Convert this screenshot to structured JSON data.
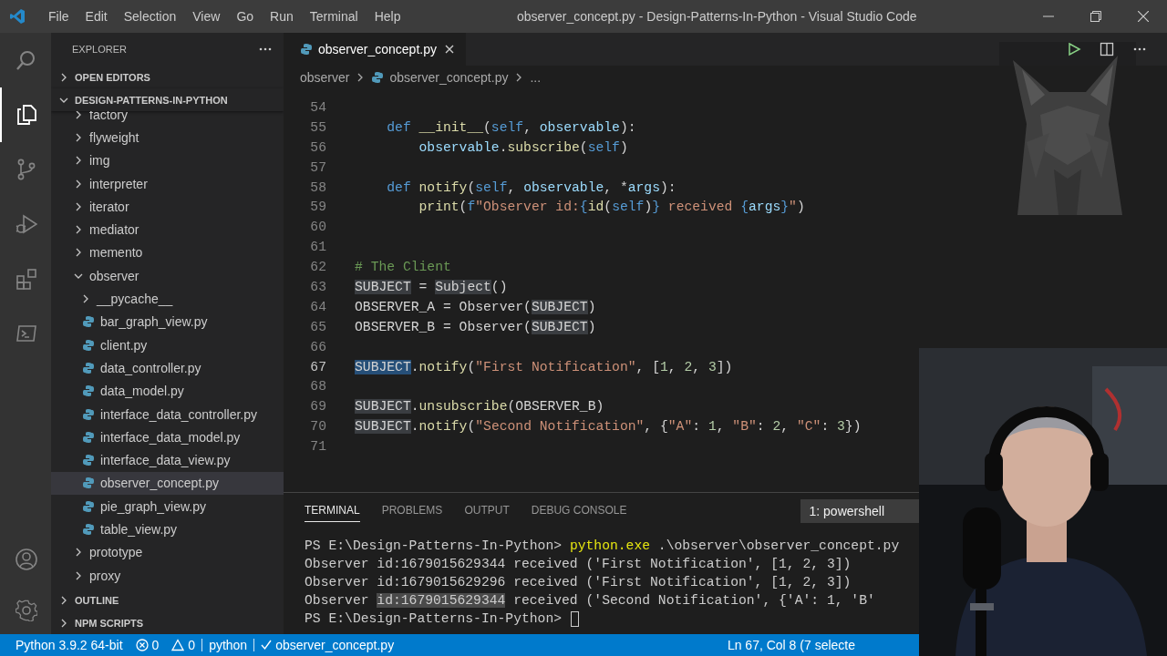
{
  "window": {
    "title": "observer_concept.py - Design-Patterns-In-Python - Visual Studio Code"
  },
  "menu": [
    "File",
    "Edit",
    "Selection",
    "View",
    "Go",
    "Run",
    "Terminal",
    "Help"
  ],
  "activity_bar": [
    {
      "kind": "search",
      "selected": false
    },
    {
      "kind": "explorer",
      "selected": true
    },
    {
      "kind": "source-control",
      "selected": false
    },
    {
      "kind": "run-debug",
      "selected": false
    },
    {
      "kind": "extensions",
      "selected": false
    },
    {
      "kind": "terminal",
      "selected": false
    },
    {
      "kind": "account",
      "selected": false
    },
    {
      "kind": "settings",
      "selected": false
    }
  ],
  "sidebar": {
    "title": "EXPLORER",
    "sections": [
      {
        "label": "OPEN EDITORS",
        "expanded": false
      },
      {
        "label": "DESIGN-PATTERNS-IN-PYTHON",
        "expanded": true,
        "tree": [
          {
            "label": "factory",
            "kind": "folder",
            "expanded": false,
            "selected": false
          },
          {
            "label": "flyweight",
            "kind": "folder",
            "expanded": false,
            "selected": false
          },
          {
            "label": "img",
            "kind": "folder",
            "expanded": false,
            "selected": false
          },
          {
            "label": "interpreter",
            "kind": "folder",
            "expanded": false,
            "selected": false
          },
          {
            "label": "iterator",
            "kind": "folder",
            "expanded": false,
            "selected": false
          },
          {
            "label": "mediator",
            "kind": "folder",
            "expanded": false,
            "selected": false
          },
          {
            "label": "memento",
            "kind": "folder",
            "expanded": false,
            "selected": false
          },
          {
            "label": "observer",
            "kind": "folder",
            "expanded": true,
            "selected": false,
            "children": [
              {
                "label": "__pycache__",
                "kind": "folder",
                "expanded": false,
                "selected": false
              },
              {
                "label": "bar_graph_view.py",
                "kind": "file",
                "selected": false
              },
              {
                "label": "client.py",
                "kind": "file",
                "selected": false
              },
              {
                "label": "data_controller.py",
                "kind": "file",
                "selected": false
              },
              {
                "label": "data_model.py",
                "kind": "file",
                "selected": false
              },
              {
                "label": "interface_data_controller.py",
                "kind": "file",
                "selected": false
              },
              {
                "label": "interface_data_model.py",
                "kind": "file",
                "selected": false
              },
              {
                "label": "interface_data_view.py",
                "kind": "file",
                "selected": false
              },
              {
                "label": "observer_concept.py",
                "kind": "file",
                "selected": true
              },
              {
                "label": "pie_graph_view.py",
                "kind": "file",
                "selected": false
              },
              {
                "label": "table_view.py",
                "kind": "file",
                "selected": false
              }
            ]
          },
          {
            "label": "prototype",
            "kind": "folder",
            "expanded": false,
            "selected": false
          },
          {
            "label": "proxy",
            "kind": "folder",
            "expanded": false,
            "selected": false
          }
        ]
      },
      {
        "label": "OUTLINE",
        "expanded": false
      },
      {
        "label": "NPM SCRIPTS",
        "expanded": false
      }
    ]
  },
  "editor": {
    "tabs": [
      {
        "label": "observer_concept.py",
        "selected": true
      }
    ],
    "breadcrumbs": [
      {
        "label": "observer",
        "kind": "folder"
      },
      {
        "label": "observer_concept.py",
        "kind": "file"
      },
      {
        "label": "...",
        "kind": "more"
      }
    ],
    "background_image": {
      "kind": "picture"
    },
    "lines": [
      {
        "number": "54",
        "current": false
      },
      {
        "number": "55",
        "current": false,
        "kind": "method",
        "tokens": [
          {
            "text": "def ",
            "kind": "keyword"
          },
          {
            "text": "__init__",
            "kind": "function"
          },
          {
            "text": "(",
            "kind": "plain"
          },
          {
            "text": "self",
            "kind": "self"
          },
          {
            "text": ", ",
            "kind": "plain"
          },
          {
            "text": "observable",
            "kind": "param"
          },
          {
            "text": "):",
            "kind": "plain"
          }
        ]
      },
      {
        "number": "56",
        "current": false,
        "kind": "body",
        "tokens": [
          {
            "text": "observable",
            "kind": "param"
          },
          {
            "text": ".",
            "kind": "plain"
          },
          {
            "text": "subscribe",
            "kind": "function"
          },
          {
            "text": "(",
            "kind": "plain"
          },
          {
            "text": "self",
            "kind": "self"
          },
          {
            "text": ")",
            "kind": "plain"
          }
        ]
      },
      {
        "number": "57",
        "current": false
      },
      {
        "number": "58",
        "current": false,
        "kind": "method",
        "tokens": [
          {
            "text": "def ",
            "kind": "keyword"
          },
          {
            "text": "notify",
            "kind": "function"
          },
          {
            "text": "(",
            "kind": "plain"
          },
          {
            "text": "self",
            "kind": "self"
          },
          {
            "text": ", ",
            "kind": "plain"
          },
          {
            "text": "observable",
            "kind": "param"
          },
          {
            "text": ", *",
            "kind": "plain"
          },
          {
            "text": "args",
            "kind": "param"
          },
          {
            "text": "):",
            "kind": "plain"
          }
        ]
      },
      {
        "number": "59",
        "current": false,
        "kind": "body",
        "tokens": [
          {
            "text": "print",
            "kind": "function"
          },
          {
            "text": "(",
            "kind": "plain"
          },
          {
            "text": "f",
            "kind": "keyword"
          },
          {
            "text": "\"Observer id:",
            "kind": "string"
          },
          {
            "text": "{",
            "kind": "keyword"
          },
          {
            "text": "id",
            "kind": "function"
          },
          {
            "text": "(",
            "kind": "plain"
          },
          {
            "text": "self",
            "kind": "self"
          },
          {
            "text": ")",
            "kind": "plain"
          },
          {
            "text": "}",
            "kind": "keyword"
          },
          {
            "text": " received ",
            "kind": "string"
          },
          {
            "text": "{",
            "kind": "keyword"
          },
          {
            "text": "args",
            "kind": "param"
          },
          {
            "text": "}",
            "kind": "keyword"
          },
          {
            "text": "\"",
            "kind": "string"
          },
          {
            "text": ")",
            "kind": "plain"
          }
        ]
      },
      {
        "number": "60",
        "current": false
      },
      {
        "number": "61",
        "current": false
      },
      {
        "number": "62",
        "current": false,
        "kind": "top",
        "tokens": [
          {
            "text": "# The Client",
            "kind": "comment"
          }
        ]
      },
      {
        "number": "63",
        "current": false,
        "kind": "top",
        "tokens": [
          {
            "text": "SUBJECT",
            "kind": "match"
          },
          {
            "text": " = ",
            "kind": "plain"
          },
          {
            "text": "Subject",
            "kind": "match"
          },
          {
            "text": "()",
            "kind": "plain"
          }
        ]
      },
      {
        "number": "64",
        "current": false,
        "kind": "top",
        "tokens": [
          {
            "text": "OBSERVER_A = Observer(",
            "kind": "plain"
          },
          {
            "text": "SUBJECT",
            "kind": "match"
          },
          {
            "text": ")",
            "kind": "plain"
          }
        ]
      },
      {
        "number": "65",
        "current": false,
        "kind": "top",
        "tokens": [
          {
            "text": "OBSERVER_B = Observer(",
            "kind": "plain"
          },
          {
            "text": "SUBJECT",
            "kind": "match"
          },
          {
            "text": ")",
            "kind": "plain"
          }
        ]
      },
      {
        "number": "66",
        "current": false
      },
      {
        "number": "67",
        "current": true,
        "kind": "top",
        "tokens": [
          {
            "text": "SUBJECT",
            "kind": "selection"
          },
          {
            "text": ".",
            "kind": "plain"
          },
          {
            "text": "notify",
            "kind": "function"
          },
          {
            "text": "(",
            "kind": "plain"
          },
          {
            "text": "\"First Notification\"",
            "kind": "string"
          },
          {
            "text": ", [",
            "kind": "plain"
          },
          {
            "text": "1",
            "kind": "number"
          },
          {
            "text": ", ",
            "kind": "plain"
          },
          {
            "text": "2",
            "kind": "number"
          },
          {
            "text": ", ",
            "kind": "plain"
          },
          {
            "text": "3",
            "kind": "number"
          },
          {
            "text": "])",
            "kind": "plain"
          }
        ]
      },
      {
        "number": "68",
        "current": false
      },
      {
        "number": "69",
        "current": false,
        "kind": "top",
        "tokens": [
          {
            "text": "SUBJECT",
            "kind": "match"
          },
          {
            "text": ".",
            "kind": "plain"
          },
          {
            "text": "unsubscribe",
            "kind": "function"
          },
          {
            "text": "(OBSERVER_B)",
            "kind": "plain"
          }
        ]
      },
      {
        "number": "70",
        "current": false,
        "kind": "top",
        "tokens": [
          {
            "text": "SUBJECT",
            "kind": "match"
          },
          {
            "text": ".",
            "kind": "plain"
          },
          {
            "text": "notify",
            "kind": "function"
          },
          {
            "text": "(",
            "kind": "plain"
          },
          {
            "text": "\"Second Notification\"",
            "kind": "string"
          },
          {
            "text": ", {",
            "kind": "plain"
          },
          {
            "text": "\"A\"",
            "kind": "string"
          },
          {
            "text": ": ",
            "kind": "plain"
          },
          {
            "text": "1",
            "kind": "number"
          },
          {
            "text": ", ",
            "kind": "plain"
          },
          {
            "text": "\"B\"",
            "kind": "string"
          },
          {
            "text": ": ",
            "kind": "plain"
          },
          {
            "text": "2",
            "kind": "number"
          },
          {
            "text": ", ",
            "kind": "plain"
          },
          {
            "text": "\"C\"",
            "kind": "string"
          },
          {
            "text": ": ",
            "kind": "plain"
          },
          {
            "text": "3",
            "kind": "number"
          },
          {
            "text": "})",
            "kind": "plain"
          }
        ]
      },
      {
        "number": "71",
        "current": false
      }
    ]
  },
  "panel": {
    "tabs": [
      {
        "label": "TERMINAL",
        "selected": true
      },
      {
        "label": "PROBLEMS",
        "selected": false
      },
      {
        "label": "OUTPUT",
        "selected": false
      },
      {
        "label": "DEBUG CONSOLE",
        "selected": false
      }
    ],
    "terminal_selector": "1: powershell",
    "terminal_lines": [
      {
        "cursor": false,
        "segments": [
          {
            "text": "PS E:\\Design-Patterns-In-Python> ",
            "kind": "plain"
          },
          {
            "text": "python.exe",
            "kind": "command"
          },
          {
            "text": " .\\observer\\observer_concept.py",
            "kind": "plain"
          }
        ]
      },
      {
        "cursor": false,
        "segments": [
          {
            "text": "Observer id:1679015629344 received ('First Notification', [1, 2, 3])",
            "kind": "plain"
          }
        ]
      },
      {
        "cursor": false,
        "segments": [
          {
            "text": "Observer id:1679015629296 received ('First Notification', [1, 2, 3])",
            "kind": "plain"
          }
        ]
      },
      {
        "cursor": false,
        "segments": [
          {
            "text": "Observer ",
            "kind": "plain"
          },
          {
            "text": "id:1679015629344",
            "kind": "highlight"
          },
          {
            "text": " received ('Second Notification', {'A': 1, 'B'",
            "kind": "plain"
          }
        ]
      },
      {
        "cursor": true,
        "segments": [
          {
            "text": "PS E:\\Design-Patterns-In-Python> ",
            "kind": "plain"
          }
        ]
      }
    ]
  },
  "status_bar": {
    "left": [
      {
        "kind": "text",
        "text": "Python 3.9.2 64-bit"
      },
      {
        "kind": "errors",
        "text": "0"
      },
      {
        "kind": "warnings",
        "text": "0"
      },
      {
        "kind": "text",
        "text": "python"
      },
      {
        "kind": "check",
        "text": "observer_concept.py"
      }
    ],
    "right": [
      "Ln 67, Col 8 (7 selecte"
    ]
  },
  "webcam": {
    "kind": "picture"
  }
}
